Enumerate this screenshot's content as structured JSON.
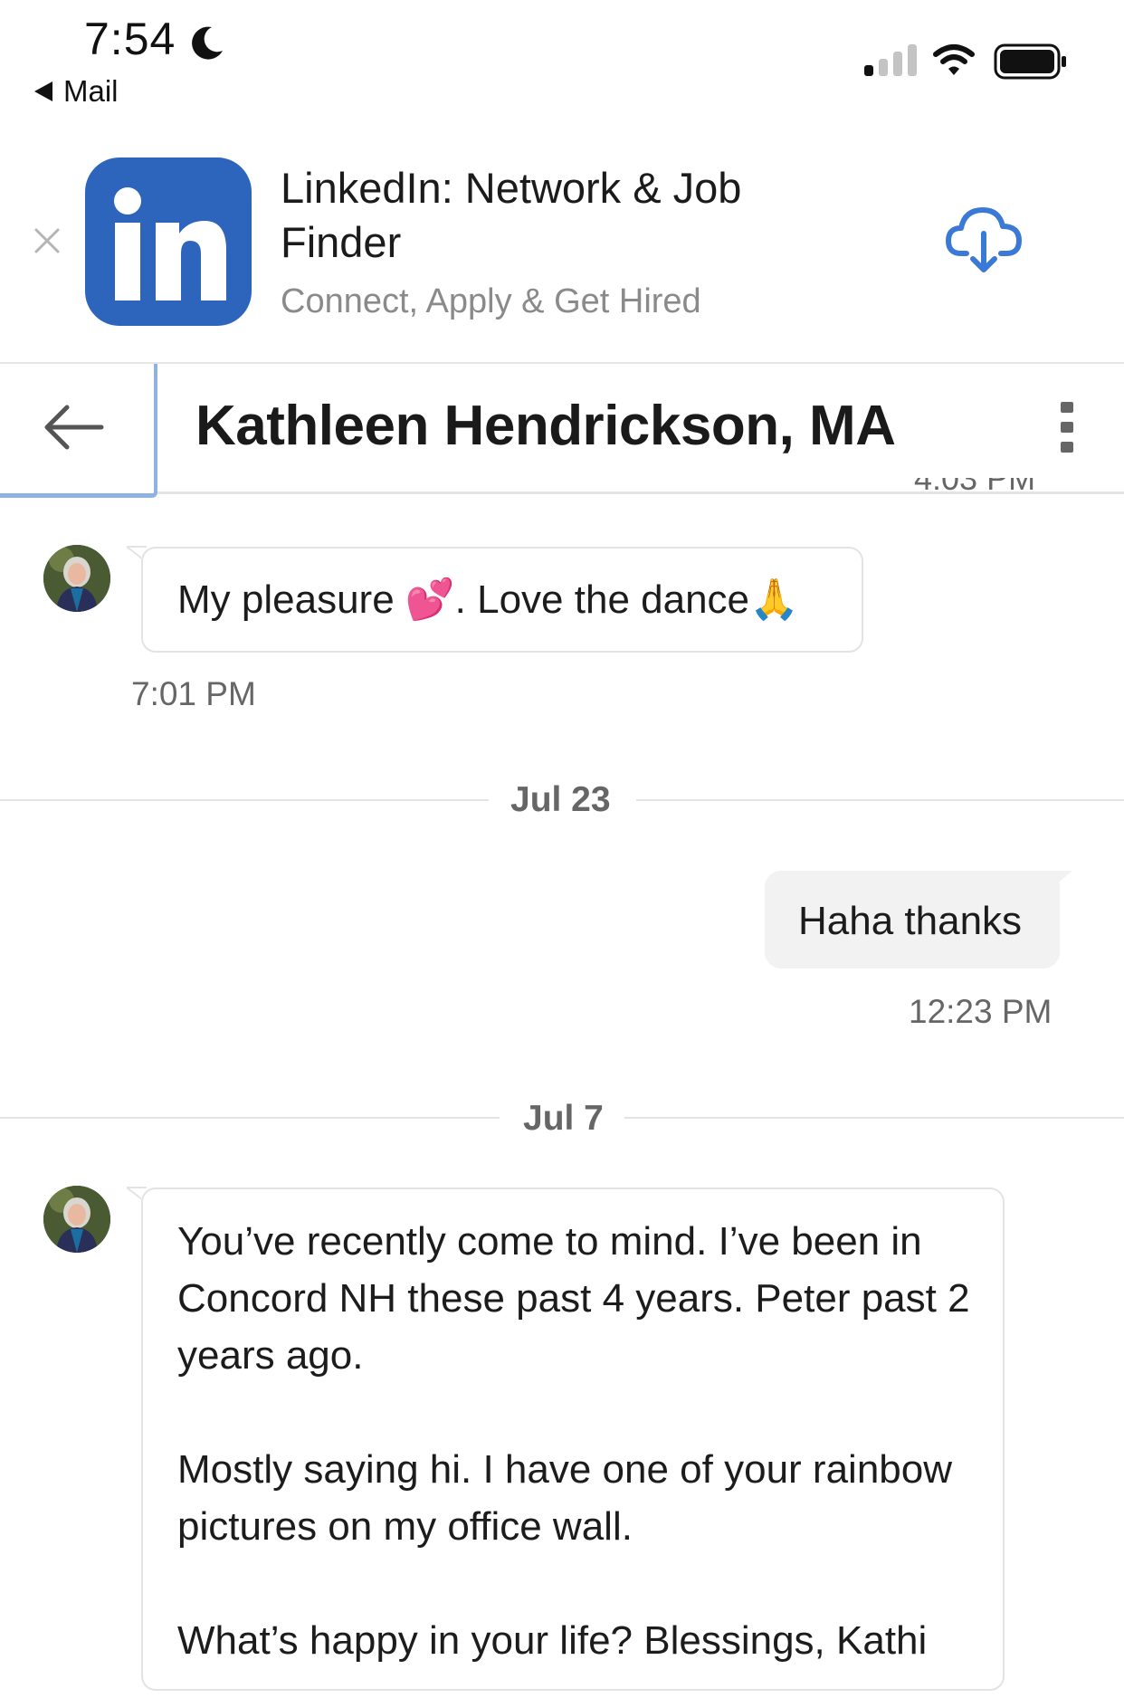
{
  "status_bar": {
    "time": "7:54",
    "back_label": "Mail"
  },
  "app_banner": {
    "name": "LinkedIn: Network & Job Finder",
    "subtitle": "Connect, Apply & Get Hired",
    "logo_text": "in",
    "brand_color": "#2d64bc",
    "accent_color": "#3b79d6"
  },
  "conversation": {
    "title": "Kathleen Hendrickson, MA",
    "clipped_time": "4:03 PM",
    "messages": [
      {
        "from": "them",
        "text": "My pleasure 💕. Love the dance🙏",
        "time": "7:01 PM"
      },
      {
        "date_separator": "Jul 23"
      },
      {
        "from": "me",
        "text": "Haha thanks",
        "time": "12:23 PM"
      },
      {
        "date_separator": "Jul 7"
      },
      {
        "from": "them",
        "paragraphs": [
          "You’ve recently come to mind. I’ve been in Concord NH these past 4 years. Peter past 2 years ago.",
          "Mostly saying hi. I have one of your rainbow pictures on my office wall.",
          "What’s happy in your life? Blessings, Kathi"
        ]
      }
    ]
  }
}
